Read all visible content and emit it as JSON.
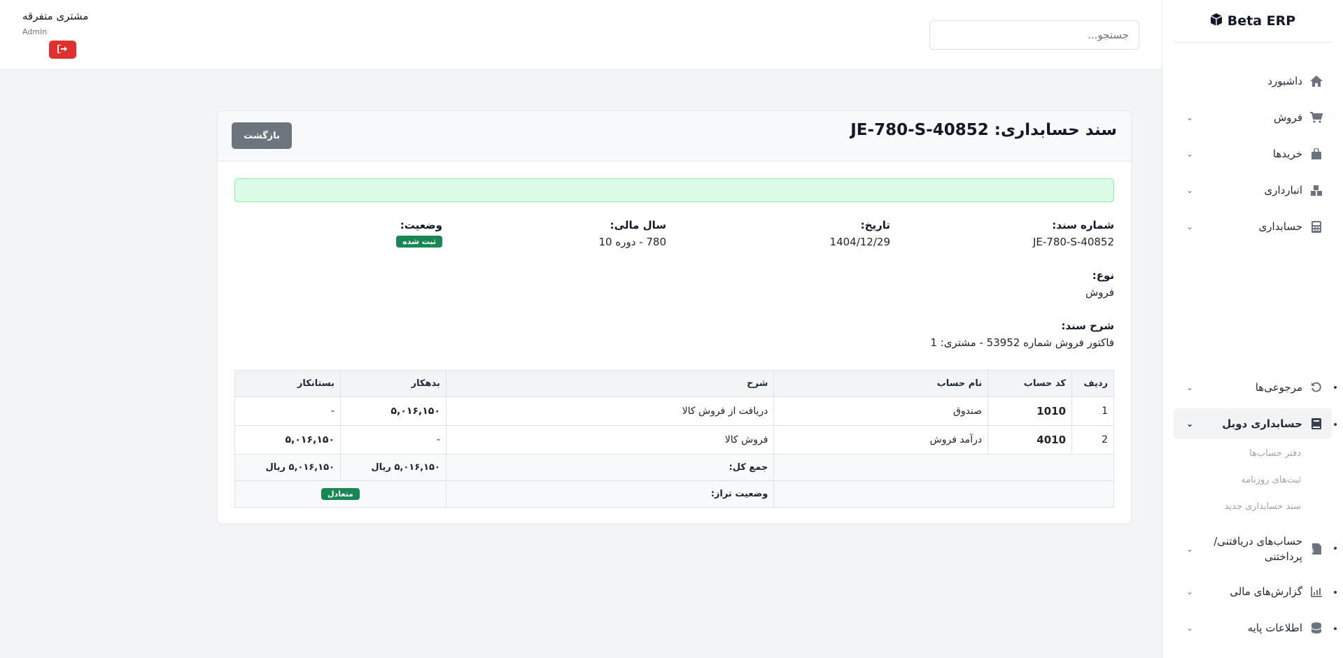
{
  "sidebar": {
    "brand": "Beta ERP",
    "items": [
      {
        "label": "داشبورد",
        "icon": "home-icon"
      },
      {
        "label": "فروش",
        "icon": "cart-icon"
      },
      {
        "label": "خریدها",
        "icon": "bag-icon"
      },
      {
        "label": "انبارداری",
        "icon": "boxes-icon"
      },
      {
        "label": "حسابداری",
        "icon": "calculator-icon"
      },
      {
        "label": "مرجوعی‌ها",
        "icon": "undo-icon"
      },
      {
        "label": "حسابداری دوبل",
        "icon": "book-icon"
      },
      {
        "label": "حساب‌های دریافتنی/پرداختنی",
        "icon": "invoice-icon"
      },
      {
        "label": "گزارش‌های مالی",
        "icon": "chart-icon"
      },
      {
        "label": "اطلاعات پایه",
        "icon": "database-icon"
      }
    ],
    "subitems": [
      "دفتر حساب‌ها",
      "ثبت‌های روزنامه",
      "سند حسابداری جدید"
    ]
  },
  "topbar": {
    "search_placeholder": "جستجو...",
    "user_name": "مشتری متفرقه",
    "user_role": "Admin"
  },
  "document": {
    "title": "سند حسابداری: JE-780-S-40852",
    "back_label": "بازگشت",
    "fields": {
      "number_label": "شماره سند:",
      "number_value": "JE-780-S-40852",
      "date_label": "تاریخ:",
      "date_value": "1404/12/29",
      "fiscal_label": "سال مالی:",
      "fiscal_value": "780 - دوره 10",
      "status_label": "وضعیت:",
      "status_value": "ثبت شده",
      "type_label": "نوع:",
      "type_value": "فروش",
      "desc_label": "شرح سند:",
      "desc_value": "فاکتور فروش شماره 53952 - مشتری: 1"
    },
    "table": {
      "headers": [
        "ردیف",
        "کد حساب",
        "نام حساب",
        "شرح",
        "بدهکار",
        "بستانکار"
      ],
      "rows": [
        {
          "row": "1",
          "code": "1010",
          "name": "صندوق",
          "desc": "دریافت از فروش کالا",
          "debit": "۵,۰۱۶,۱۵۰",
          "credit": "-"
        },
        {
          "row": "2",
          "code": "4010",
          "name": "درآمد فروش",
          "desc": "فروش کالا",
          "debit": "-",
          "credit": "۵,۰۱۶,۱۵۰"
        }
      ],
      "total_label": "جمع کل:",
      "total_debit": "۵,۰۱۶,۱۵۰ ریال",
      "total_credit": "۵,۰۱۶,۱۵۰ ریال",
      "balance_label": "وضعیت تراز:",
      "balance_value": "متعادل"
    }
  },
  "colors": {
    "primary_button": "#6c757d",
    "success": "#198754",
    "danger": "#e03131",
    "alert_bg": "#dcfce7"
  }
}
